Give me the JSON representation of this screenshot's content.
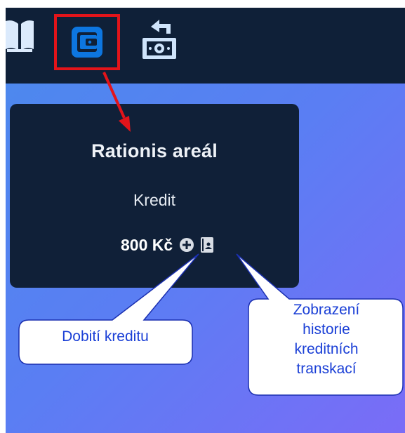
{
  "toolbar": {
    "book_icon": "book-open-icon",
    "wallet_icon": "wallet-icon",
    "exchange_icon": "money-exchange-icon"
  },
  "card": {
    "title": "Rationis areál",
    "subtitle": "Kredit",
    "amount": "800 Kč",
    "add_icon": "plus-circle-icon",
    "history_icon": "history-book-icon"
  },
  "callouts": {
    "top_up": "Dobití kreditu",
    "history_lines": [
      "Zobrazení",
      "historie",
      "kreditních",
      "transkací"
    ]
  },
  "colors": {
    "topbar": "#0f2038",
    "card": "#102038",
    "accent_blue": "#0d76e0",
    "highlight_red": "#e3141a",
    "callout_text": "#1a3fd6"
  }
}
